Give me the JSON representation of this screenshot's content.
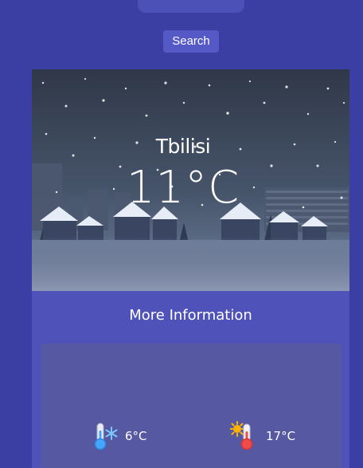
{
  "search": {
    "value": "",
    "placeholder": "",
    "button_label": "Search"
  },
  "weather": {
    "city": "Tbilisi",
    "temperature": "11°C"
  },
  "more_info": {
    "title": "More Information",
    "min_temp": "6°C",
    "max_temp": "17°C",
    "min_icon": "thermometer-cold-icon",
    "max_icon": "thermometer-hot-icon"
  },
  "colors": {
    "background": "#3b3fa3",
    "card": "#4f52b9",
    "panel": "#5658a1",
    "accent": "#5459c6"
  }
}
